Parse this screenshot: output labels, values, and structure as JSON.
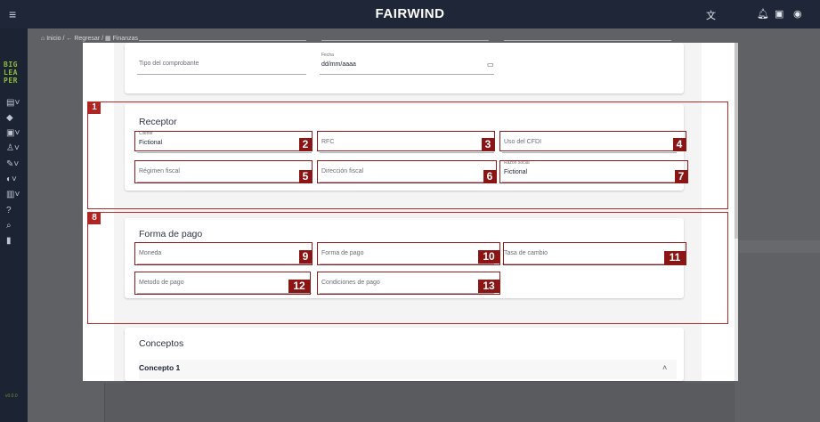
{
  "app": {
    "brand": "FAIRWIND",
    "logo_lines": [
      "BIG",
      "LEA",
      "PER"
    ],
    "footer_text": "v0.0.0"
  },
  "breadcrumb": {
    "home": "Inicio",
    "back": "Regresar",
    "current": "Finanzas",
    "separator": "/"
  },
  "top_card": {
    "tipo_comprobante_label": "Tipo del comprobante",
    "fecha_label": "Fecha",
    "fecha_value": "dd/mm/aaaa"
  },
  "receptor": {
    "title": "Receptor",
    "cliente_label": "Cliente",
    "cliente_value": "Fictional",
    "rfc_label": "RFC",
    "uso_cfdi_label": "Uso del CFDI",
    "regimen_label": "Régimen fiscal",
    "direccion_label": "Dirección fiscal",
    "razon_label": "Razón social",
    "razon_value": "Fictional"
  },
  "forma_pago_section": {
    "title": "Forma de pago",
    "moneda_label": "Moneda",
    "forma_pago_label": "Forma de pago",
    "tasa_cambio_label": "Tasa de cambio",
    "metodo_pago_label": "Metodo de pago",
    "condiciones_label": "Condiciones de pago"
  },
  "conceptos": {
    "title": "Conceptos",
    "item_title": "Concepto 1"
  },
  "annotations": {
    "tags": [
      "1",
      "2",
      "3",
      "4",
      "5",
      "6",
      "7",
      "8",
      "9",
      "10",
      "11",
      "12",
      "13"
    ]
  },
  "colors": {
    "topbar": "#1f2637",
    "overlay": "#606165",
    "annotation_red": "#8b1414"
  }
}
